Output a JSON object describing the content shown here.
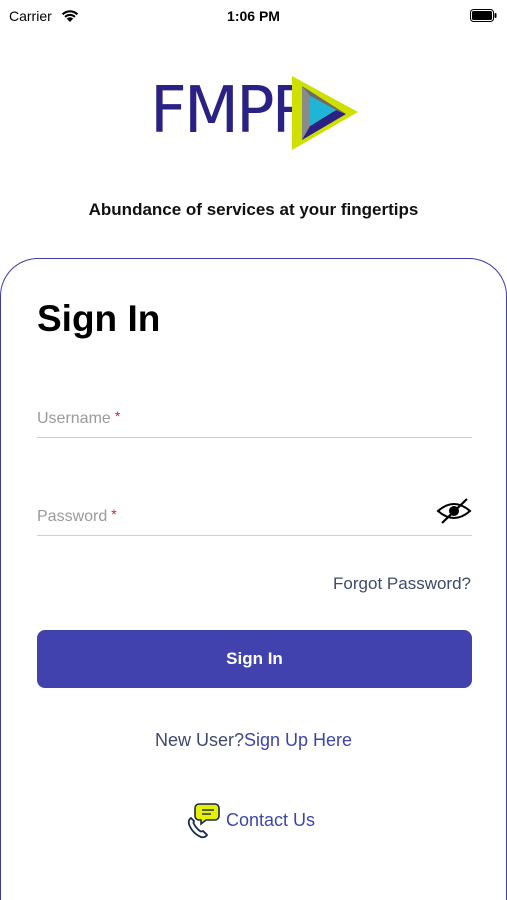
{
  "status_bar": {
    "carrier": "Carrier",
    "time": "1:06 PM",
    "icons": [
      "wifi-icon",
      "battery-icon"
    ]
  },
  "brand": {
    "logo_text": "FMPR",
    "tagline": "Abundance of services at your fingertips",
    "colors": {
      "primary": "#2a2185",
      "accent_yellow": "#cfe000",
      "accent_cyan": "#1fb5d6",
      "gray": "#8a8a8a"
    }
  },
  "form": {
    "title": "Sign In",
    "username": {
      "placeholder": "Username",
      "value": "",
      "required_mark": "*"
    },
    "password": {
      "placeholder": "Password",
      "value": "",
      "required_mark": "*",
      "toggle_icon": "eye-slash-icon"
    },
    "forgot_password": "Forgot Password?",
    "submit_label": "Sign In",
    "new_user_prompt": "New User?",
    "sign_up_link": "Sign Up Here",
    "contact_label": "Contact Us",
    "contact_icon": "phone-chat-icon"
  },
  "colors": {
    "button": "#4242af",
    "card_border": "#3e3da8",
    "link": "#3d46a8",
    "required": "#d81b2b"
  }
}
